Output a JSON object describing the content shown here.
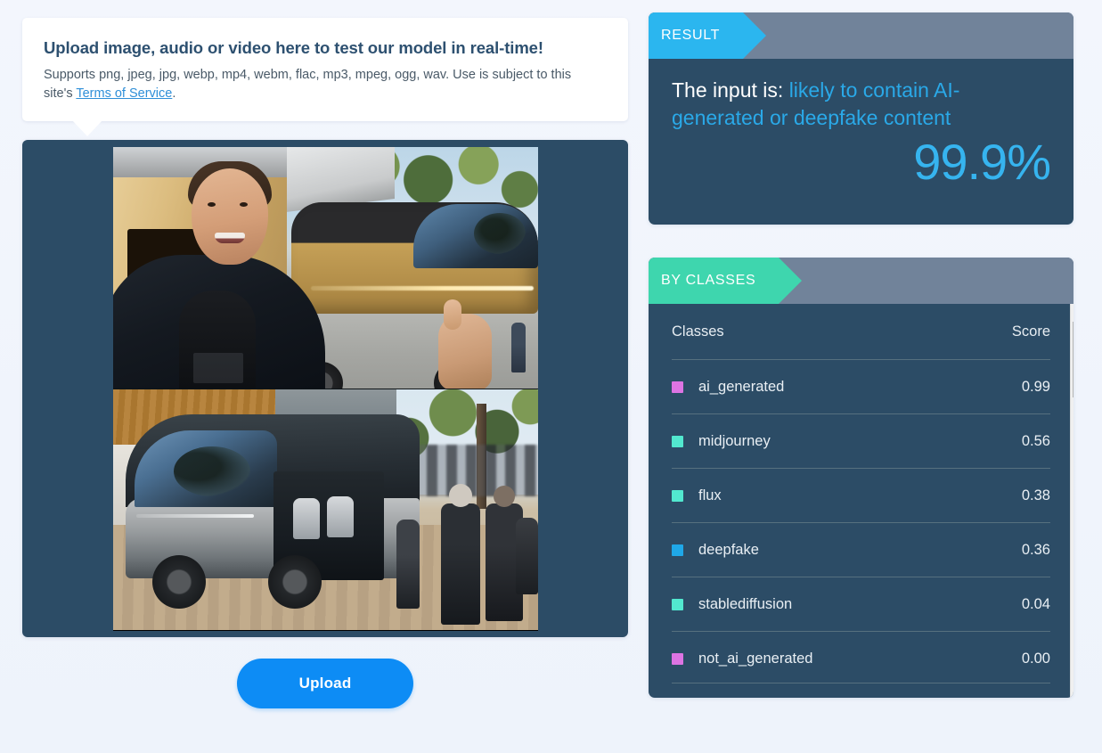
{
  "page": {
    "background_color": "#f1f5fc"
  },
  "info_card": {
    "title": "Upload image, audio or video here to test our model in real-time!",
    "description_before_link": "Supports png, jpeg, jpg, webp, mp4, webm, flac, mp3, mpeg, ogg, wav. Use is subject to this site's ",
    "link_label": "Terms of Service",
    "description_after_link": "."
  },
  "media_panel": {
    "top_photo_alt": "Man smiling with thumbs up in front of a gold autonomous van",
    "bottom_photo_alt": "Silver autonomous van with open side door and crowd of people"
  },
  "upload": {
    "button_label": "Upload"
  },
  "result_panel": {
    "tag_label": "RESULT",
    "tag_color": "#2bb6ef",
    "prefix": "The input is: ",
    "verdict": "likely to contain AI-generated or deepfake content",
    "verdict_color": "#2aa9e8",
    "percentage": "99.9%",
    "percentage_color": "#36b4ef"
  },
  "classes_panel": {
    "tag_label": "BY CLASSES",
    "tag_color": "#3ed6ae",
    "column_headers": {
      "name": "Classes",
      "score": "Score"
    },
    "rows": [
      {
        "name": "ai_generated",
        "score": "0.99",
        "color": "#dd74e3"
      },
      {
        "name": "midjourney",
        "score": "0.56",
        "color": "#52e8cf"
      },
      {
        "name": "flux",
        "score": "0.38",
        "color": "#52e8cf"
      },
      {
        "name": "deepfake",
        "score": "0.36",
        "color": "#1fa8e8"
      },
      {
        "name": "stablediffusion",
        "score": "0.04",
        "color": "#52e8cf"
      },
      {
        "name": "not_ai_generated",
        "score": "0.00",
        "color": "#dd74e3"
      }
    ],
    "scrollbar": {
      "up_arrow": "▲",
      "down_arrow": "▼"
    }
  },
  "chart_data": {
    "type": "bar",
    "title": "BY CLASSES",
    "categories": [
      "ai_generated",
      "midjourney",
      "flux",
      "deepfake",
      "stablediffusion",
      "not_ai_generated"
    ],
    "values": [
      0.99,
      0.56,
      0.38,
      0.36,
      0.04,
      0.0
    ],
    "xlabel": "Classes",
    "ylabel": "Score",
    "ylim": [
      0,
      1
    ],
    "legend": "none",
    "grid": false
  }
}
